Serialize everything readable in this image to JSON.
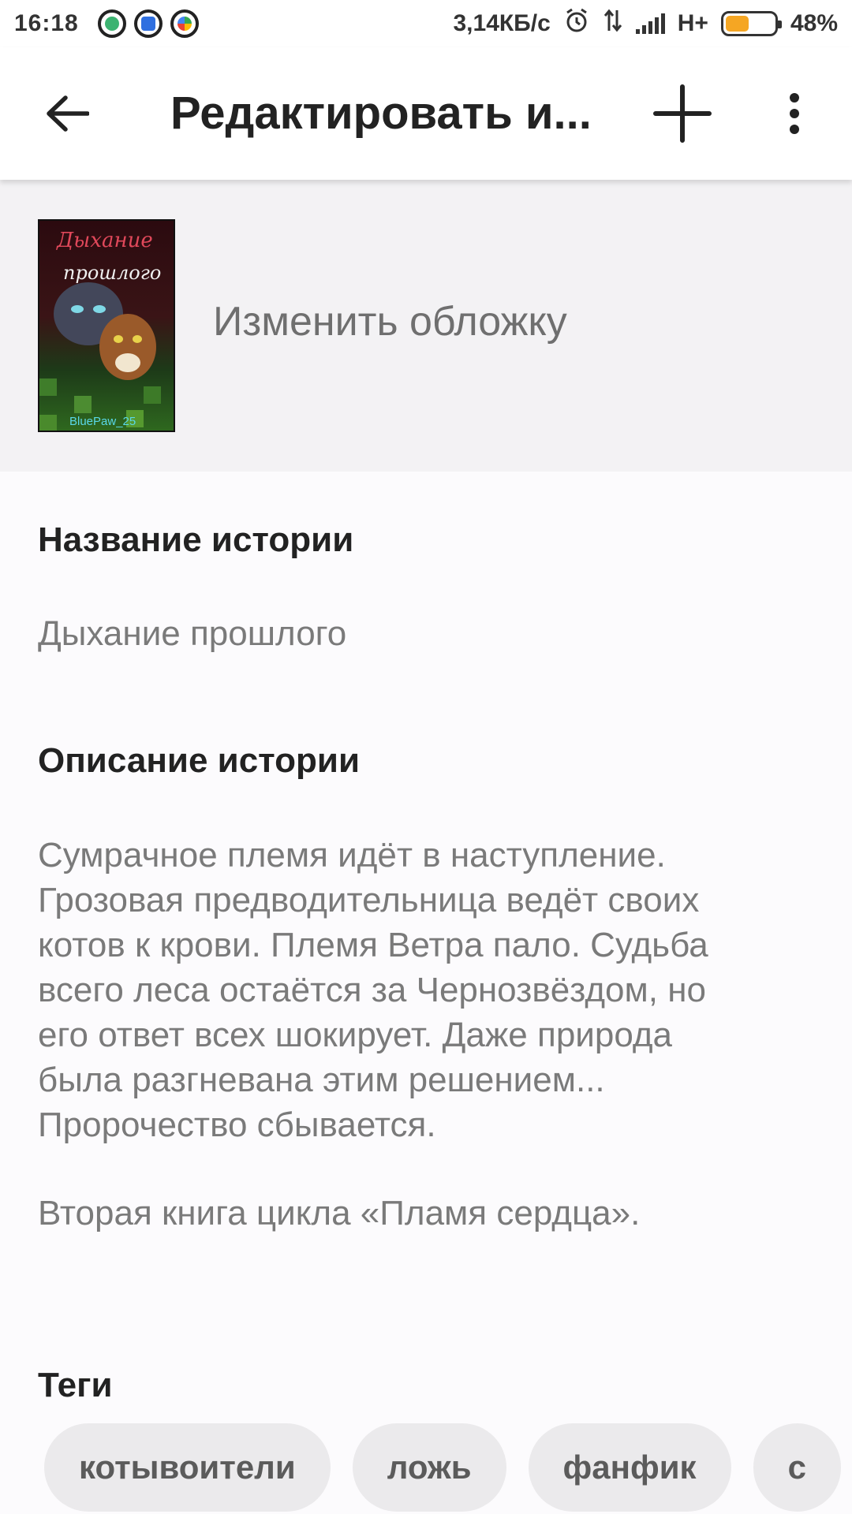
{
  "status_bar": {
    "time": "16:18",
    "network_speed": "3,14КБ/с",
    "network_type": "H+",
    "battery_percent": "48%",
    "battery_level": 0.48,
    "icons": [
      "android-app-icon",
      "blue-app-icon",
      "play-store-icon",
      "alarm-icon",
      "data-transfer-icon",
      "signal-icon",
      "battery-icon"
    ]
  },
  "toolbar": {
    "title": "Редактировать и...",
    "back_icon": "arrow-left-icon",
    "add_icon": "plus-icon",
    "more_icon": "more-vertical-icon"
  },
  "cover": {
    "title_line1": "Дыхание",
    "title_line2": "прошлого",
    "author": "BluePaw_25",
    "change_label": "Изменить обложку"
  },
  "story": {
    "title_label": "Название истории",
    "title_value": "Дыхание прошлого",
    "description_label": "Описание истории",
    "description_lines": [
      "Сумрачное племя идёт в наступление.",
      "Грозовая предводительница ведёт своих",
      "котов к крови. Племя Ветра пало. Судьба",
      "всего леса остаётся за Чернозвёздом, но",
      "его ответ всех шокирует. Даже природа",
      "была разгневана этим решением...",
      "Пророчество сбывается."
    ],
    "description_footer": "Вторая книга цикла «Пламя сердца»."
  },
  "tags": {
    "label": "Теги",
    "items": [
      "котывоители",
      "ложь",
      "фанфик",
      "с"
    ]
  },
  "colors": {
    "accent_battery": "#f5a623",
    "chip_bg": "#ebeaec",
    "cover_section_bg": "#f3f2f4"
  }
}
